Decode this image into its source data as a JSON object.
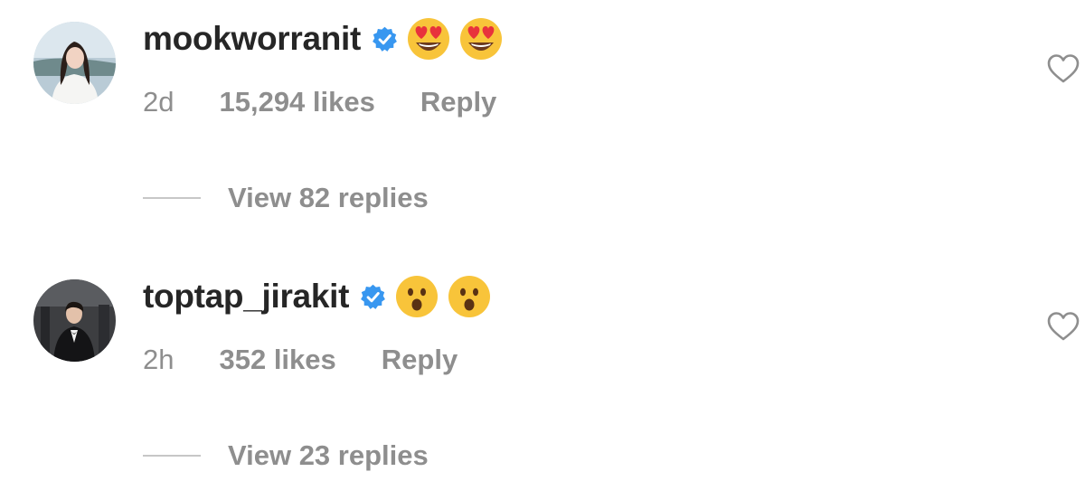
{
  "comments": [
    {
      "username": "mookworranit",
      "emoji": [
        "heart-eyes",
        "heart-eyes"
      ],
      "time": "2d",
      "likes": "15,294 likes",
      "reply_label": "Reply",
      "view_replies": "View 82 replies"
    },
    {
      "username": "toptap_jirakit",
      "emoji": [
        "astonished",
        "astonished"
      ],
      "time": "2h",
      "likes": "352 likes",
      "reply_label": "Reply",
      "view_replies": "View 23 replies"
    }
  ],
  "icons": {
    "verified": "verified-badge-icon",
    "like": "heart-outline-icon"
  },
  "colors": {
    "username": "#262626",
    "secondary_text": "#8e8e8e",
    "verified_blue": "#3897f0",
    "divider": "#c7c7c7"
  }
}
